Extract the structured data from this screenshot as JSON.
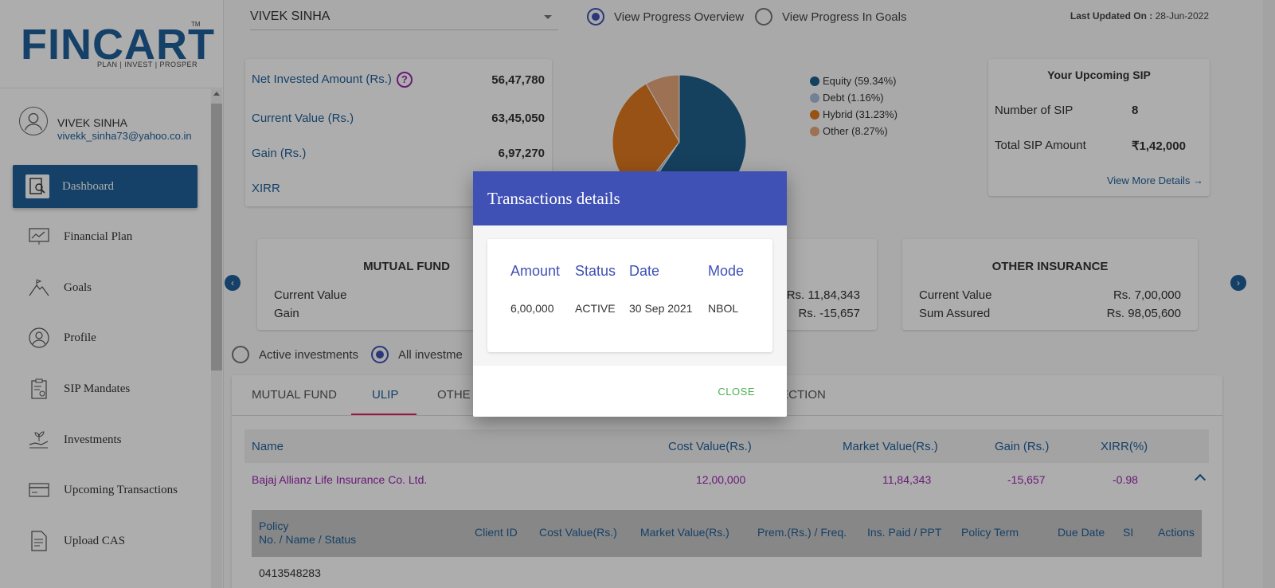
{
  "brand": {
    "name": "FINCART",
    "tm": "TM",
    "tagline": "PLAN | INVEST | PROSPER"
  },
  "user": {
    "name": "VIVEK SINHA",
    "email": "vivekk_sinha73@yahoo.co.in"
  },
  "sidebar": {
    "items": [
      {
        "label": "Dashboard",
        "icon": "dashboard-icon",
        "active": true
      },
      {
        "label": "Financial Plan",
        "icon": "chart-line-icon"
      },
      {
        "label": "Goals",
        "icon": "mountain-flag-icon"
      },
      {
        "label": "Profile",
        "icon": "user-circle-icon"
      },
      {
        "label": "SIP Mandates",
        "icon": "clipboard-icon"
      },
      {
        "label": "Investments",
        "icon": "hand-coins-icon"
      },
      {
        "label": "Upcoming Transactions",
        "icon": "card-icon"
      },
      {
        "label": "Upload CAS",
        "icon": "upload-doc-icon"
      }
    ]
  },
  "header": {
    "investor": "VIVEK SINHA",
    "view_overview": "View Progress Overview",
    "view_goals": "View Progress In Goals",
    "updated_label": "Last Updated On :",
    "updated_value": "28-Jun-2022"
  },
  "summary": {
    "net_invested_label": "Net Invested Amount (Rs.)",
    "net_invested_value": "56,47,780",
    "current_value_label": "Current Value (Rs.)",
    "current_value_value": "63,45,050",
    "gain_label": "Gain (Rs.)",
    "gain_value": "6,97,270",
    "xirr_label": "XIRR",
    "help": "?"
  },
  "chart_data": {
    "type": "pie",
    "slices": [
      {
        "label": "Equity (59.34%)",
        "value": 59.34,
        "color": "#1f5f8b"
      },
      {
        "label": "Debt (1.16%)",
        "value": 1.16,
        "color": "#a7c0dc"
      },
      {
        "label": "Hybrid (31.23%)",
        "value": 31.23,
        "color": "#e07a1f"
      },
      {
        "label": "Other (8.27%)",
        "value": 8.27,
        "color": "#e8a87c"
      }
    ]
  },
  "sip": {
    "title": "Your Upcoming SIP",
    "count_label": "Number of SIP",
    "count_value": "8",
    "amount_label": "Total SIP Amount",
    "amount_value": "₹1,42,000",
    "more": "View More Details →"
  },
  "products": {
    "mf": {
      "title": "MUTUAL FUND",
      "r1": "Current Value",
      "r2": "Gain"
    },
    "ulip": {
      "v1": "Rs. 11,84,343",
      "v2": "Rs. -15,657"
    },
    "other": {
      "title": "OTHER INSURANCE",
      "r1": "Current Value",
      "v1": "Rs. 7,00,000",
      "r2": "Sum Assured",
      "v2": "Rs. 98,05,600"
    }
  },
  "filters": {
    "active": "Active investments",
    "all": "All investme"
  },
  "tabs": [
    "MUTUAL FUND",
    "ULIP",
    "OTHE",
    "TECTION"
  ],
  "table": {
    "headers": [
      "Name",
      "Cost Value(Rs.)",
      "Market Value(Rs.)",
      "Gain (Rs.)",
      "XIRR(%)"
    ],
    "row": [
      "Bajaj Allianz Life Insurance Co. Ltd.",
      "12,00,000",
      "11,84,343",
      "-15,657",
      "-0.98"
    ],
    "sub_headers": [
      "Policy",
      "No. / Name / Status",
      "Client ID",
      "Cost Value(Rs.)",
      "Market Value(Rs.)",
      "Prem.(Rs.) / Freq.",
      "Ins. Paid / PPT",
      "Policy Term",
      "Due Date",
      "SI",
      "Actions"
    ],
    "sub_row": "0413548283"
  },
  "modal": {
    "title": "Transactions details",
    "headers": [
      "Amount",
      "Status",
      "Date",
      "Mode"
    ],
    "row": [
      "6,00,000",
      "ACTIVE",
      "30 Sep 2021",
      "NBOL"
    ],
    "close": "CLOSE"
  }
}
